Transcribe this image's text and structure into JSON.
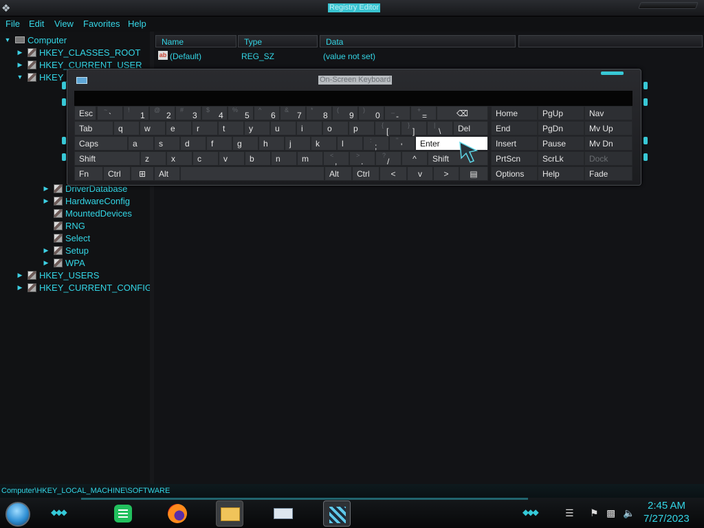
{
  "window": {
    "title": "Registry Editor"
  },
  "menu": [
    "File",
    "Edit",
    "View",
    "Favorites",
    "Help"
  ],
  "tree": {
    "root": "Computer",
    "items": [
      {
        "label": "HKEY_CLASSES_ROOT",
        "expander": ">"
      },
      {
        "label": "HKEY_CURRENT_USER",
        "expander": ">"
      },
      {
        "label": "HKEY_LOCAL_MACHINE",
        "expander": "v"
      },
      {
        "label": "DriverDatabase",
        "expander": ">"
      },
      {
        "label": "HardwareConfig",
        "expander": ">"
      },
      {
        "label": "MountedDevices",
        "expander": ""
      },
      {
        "label": "RNG",
        "expander": ""
      },
      {
        "label": "Select",
        "expander": ""
      },
      {
        "label": "Setup",
        "expander": ">"
      },
      {
        "label": "WPA",
        "expander": ">"
      },
      {
        "label": "HKEY_USERS",
        "expander": ">"
      },
      {
        "label": "HKEY_CURRENT_CONFIG",
        "expander": ">"
      }
    ]
  },
  "list": {
    "columns": [
      "Name",
      "Type",
      "Data"
    ],
    "rows": [
      {
        "name": "(Default)",
        "type": "REG_SZ",
        "data": "(value not set)"
      }
    ]
  },
  "status_path": "Computer\\HKEY_LOCAL_MACHINE\\SOFTWARE",
  "osk": {
    "title": "On-Screen Keyboard",
    "rows": [
      [
        {
          "main": "Esc"
        },
        {
          "sub": "~",
          "dig": "`",
          "sym": true
        },
        {
          "sub": "!",
          "dig": "1"
        },
        {
          "sub": "@",
          "dig": "2"
        },
        {
          "sub": "#",
          "dig": "3"
        },
        {
          "sub": "$",
          "dig": "4"
        },
        {
          "sub": "%",
          "dig": "5"
        },
        {
          "sub": "^",
          "dig": "6"
        },
        {
          "sub": "&",
          "dig": "7"
        },
        {
          "sub": "*",
          "dig": "8"
        },
        {
          "sub": "(",
          "dig": "9"
        },
        {
          "sub": ")",
          "dig": "0"
        },
        {
          "sub": "_",
          "dig": "-",
          "sym": true
        },
        {
          "sub": "+",
          "dig": "=",
          "sym": true
        },
        {
          "main": "⌫",
          "icon": "backspace-icon"
        },
        {
          "main": "Home"
        },
        {
          "main": "PgUp"
        },
        {
          "main": "Nav"
        }
      ],
      [
        {
          "main": "Tab"
        },
        {
          "main": "q"
        },
        {
          "main": "w"
        },
        {
          "main": "e"
        },
        {
          "main": "r"
        },
        {
          "main": "t"
        },
        {
          "main": "y"
        },
        {
          "main": "u"
        },
        {
          "main": "i"
        },
        {
          "main": "o"
        },
        {
          "main": "p"
        },
        {
          "sub": "{",
          "dig": "[",
          "sym": true
        },
        {
          "sub": "}",
          "dig": "]",
          "sym": true
        },
        {
          "sub": "|",
          "dig": "\\",
          "sym": true
        },
        {
          "main": "Del"
        },
        {
          "main": "End"
        },
        {
          "main": "PgDn"
        },
        {
          "main": "Mv Up"
        }
      ],
      [
        {
          "main": "Caps"
        },
        {
          "main": "a"
        },
        {
          "main": "s"
        },
        {
          "main": "d"
        },
        {
          "main": "f"
        },
        {
          "main": "g"
        },
        {
          "main": "h"
        },
        {
          "main": "j"
        },
        {
          "main": "k"
        },
        {
          "main": "l"
        },
        {
          "sub": ":",
          "dig": ";",
          "sym": true
        },
        {
          "sub": "\"",
          "dig": "'",
          "sym": true
        },
        {
          "main": "Enter",
          "active": true
        },
        {
          "main": "Insert"
        },
        {
          "main": "Pause"
        },
        {
          "main": "Mv Dn"
        }
      ],
      [
        {
          "main": "Shift"
        },
        {
          "main": "z"
        },
        {
          "main": "x"
        },
        {
          "main": "c"
        },
        {
          "main": "v"
        },
        {
          "main": "b"
        },
        {
          "main": "n"
        },
        {
          "main": "m"
        },
        {
          "sub": "<",
          "dig": ",",
          "sym": true
        },
        {
          "sub": ">",
          "dig": ".",
          "sym": true
        },
        {
          "sub": "?",
          "dig": "/",
          "sym": true
        },
        {
          "main": "^",
          "icon": "arrow-up-icon"
        },
        {
          "main": "Shift"
        },
        {
          "main": "PrtScn"
        },
        {
          "main": "ScrLk"
        },
        {
          "main": "Dock",
          "disabled": true
        }
      ],
      [
        {
          "main": "Fn"
        },
        {
          "main": "Ctrl"
        },
        {
          "main": "⊞",
          "icon": "windows-icon"
        },
        {
          "main": "Alt"
        },
        {
          "main": "",
          "icon": "spacebar"
        },
        {
          "main": "Alt"
        },
        {
          "main": "Ctrl"
        },
        {
          "main": "<",
          "icon": "arrow-left-icon"
        },
        {
          "main": "v",
          "icon": "arrow-down-icon"
        },
        {
          "main": ">",
          "icon": "arrow-right-icon"
        },
        {
          "main": "▤",
          "icon": "menu-key-icon"
        },
        {
          "main": "Options"
        },
        {
          "main": "Help"
        },
        {
          "main": "Fade"
        }
      ]
    ]
  },
  "taskbar": {
    "apps": [
      "notes-app-icon",
      "firefox-icon",
      "file-explorer-icon",
      "on-screen-keyboard-icon",
      "registry-editor-icon"
    ],
    "time": "2:45 AM",
    "date": "7/27/2023"
  },
  "colors": {
    "accent": "#33d6e6",
    "background": "#0d0e10",
    "key": "#34363a"
  }
}
